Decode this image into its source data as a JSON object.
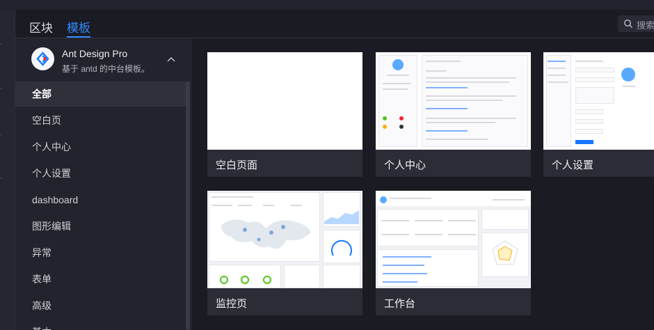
{
  "tabs": {
    "blocks": "区块",
    "templates": "模板"
  },
  "search": {
    "label": "搜索"
  },
  "sidebar": {
    "brand_title": "Ant Design Pro",
    "brand_subtitle": "基于 antd 的中台模板。",
    "items": [
      {
        "label": "全部"
      },
      {
        "label": "空白页"
      },
      {
        "label": "个人中心"
      },
      {
        "label": "个人设置"
      },
      {
        "label": "dashboard"
      },
      {
        "label": "图形编辑"
      },
      {
        "label": "异常"
      },
      {
        "label": "表单"
      },
      {
        "label": "高级"
      },
      {
        "label": "基本"
      }
    ]
  },
  "cards": [
    {
      "label": "空白页面"
    },
    {
      "label": "个人中心"
    },
    {
      "label": "个人设置"
    },
    {
      "label": "监控页"
    },
    {
      "label": "工作台"
    }
  ],
  "colors": {
    "accent": "#2f8cff",
    "background": "#1b1b24",
    "sidebar": "#23232d",
    "card": "#2c2c37"
  }
}
